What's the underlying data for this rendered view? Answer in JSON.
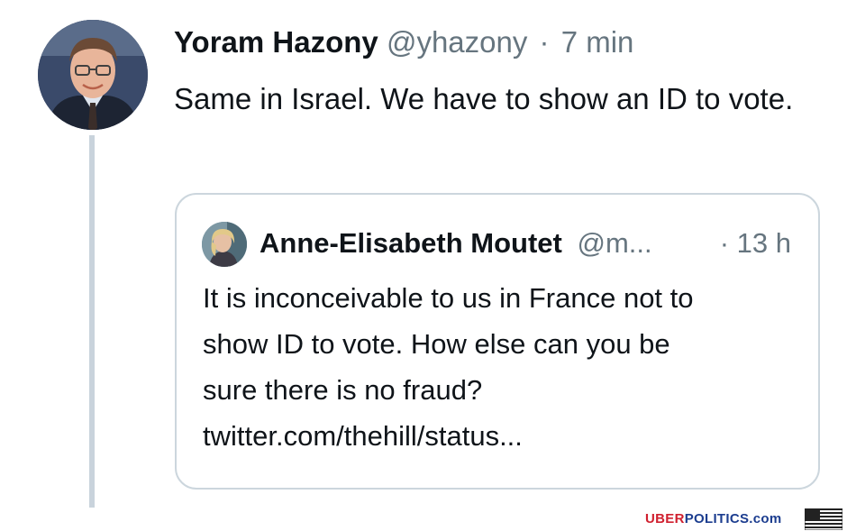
{
  "tweet": {
    "author_name": "Yoram Hazony",
    "handle": "@yhazony",
    "separator": "·",
    "timestamp": "7 min",
    "text": "Same in Israel. We have to show an ID to vote."
  },
  "quoted_tweet": {
    "author_name": "Anne-Elisabeth Moutet",
    "handle": "@m...",
    "separator": "·",
    "timestamp": "13 h",
    "text_lines": [
      "It is inconceivable to us in France not to",
      "show ID to vote. How else can you be",
      "sure there is no fraud?",
      "twitter.com/thehill/status..."
    ]
  },
  "watermark": {
    "part1": "UBER",
    "part2": "POLITICS",
    "part3": ".com"
  },
  "colors": {
    "text_primary": "#0f1419",
    "text_secondary": "#66757f",
    "thread_line": "#c9d3dc",
    "card_border": "#ccd6dd",
    "watermark_red": "#d0202f",
    "watermark_blue": "#1c3d8f"
  },
  "icons": {
    "flag": "us-flag-icon"
  }
}
